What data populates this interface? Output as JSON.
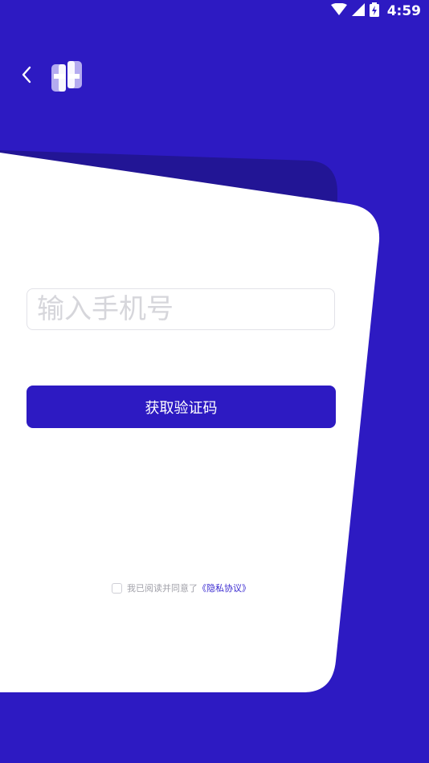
{
  "status_bar": {
    "time": "4:59",
    "icons": [
      "wifi-icon",
      "cellular-signal-icon",
      "battery-icon"
    ]
  },
  "header": {
    "back_icon": "chevron-left-icon",
    "logo_icon": "app-logo-icon"
  },
  "login": {
    "phone_placeholder": "输入手机号",
    "get_code_label": "获取验证码",
    "agreement_prefix": "我已阅读并同意了",
    "privacy_link": "《隐私协议》"
  },
  "colors": {
    "brand": "#2d1ac2",
    "card_back": "#221595",
    "card": "#ffffff",
    "link": "#3a2ad0"
  }
}
